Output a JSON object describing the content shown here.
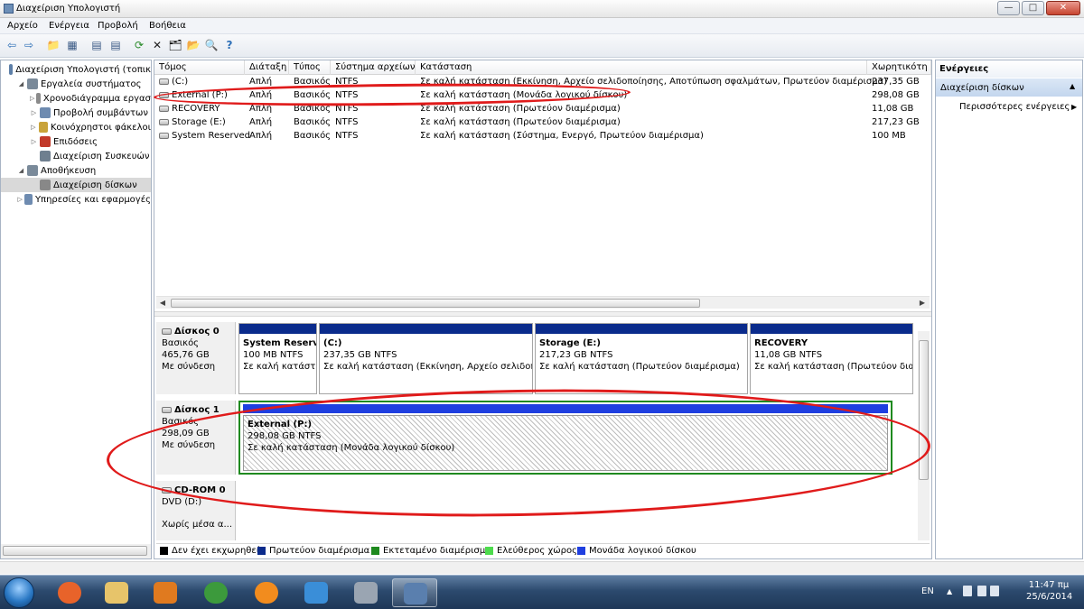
{
  "window": {
    "title": "Διαχείριση Υπολογιστή",
    "minimize_glyph": "—",
    "maximize_glyph": "□",
    "close_glyph": "✕"
  },
  "menu": [
    "Αρχείο",
    "Ενέργεια",
    "Προβολή",
    "Βοήθεια"
  ],
  "toolbar": {
    "icons": [
      "back-arrow-icon",
      "forward-arrow-icon",
      "up-folder-icon",
      "show-hide-tree-icon",
      "properties-icon",
      "refresh-icon",
      "delete-icon",
      "open-icon",
      "explore-icon",
      "search-icon",
      "help-icon"
    ],
    "glyphs": [
      "⇦",
      "⇨",
      "📁",
      "▦",
      "▤",
      "⟳",
      "✕",
      "🗂",
      "📂",
      "🔍",
      "?"
    ]
  },
  "tree": [
    {
      "label": "Διαχείριση Υπολογιστή (τοπικ",
      "expander": "",
      "level": 0,
      "icon_color": "#5d7fa8"
    },
    {
      "label": "Εργαλεία συστήματος",
      "expander": "◢",
      "level": 1,
      "icon_color": "#7a8a9a"
    },
    {
      "label": "Χρονοδιάγραμμα εργασ",
      "expander": "▷",
      "level": 2,
      "icon_color": "#8b8b8b"
    },
    {
      "label": "Προβολή συμβάντων",
      "expander": "▷",
      "level": 2,
      "icon_color": "#6e8bb0"
    },
    {
      "label": "Κοινόχρηστοι φάκελοι",
      "expander": "▷",
      "level": 2,
      "icon_color": "#c9a33a"
    },
    {
      "label": "Επιδόσεις",
      "expander": "▷",
      "level": 2,
      "icon_color": "#c23a2a"
    },
    {
      "label": "Διαχείριση Συσκευών",
      "expander": "",
      "level": 2,
      "icon_color": "#6f7f8f"
    },
    {
      "label": "Αποθήκευση",
      "expander": "◢",
      "level": 1,
      "icon_color": "#7a8a9a"
    },
    {
      "label": "Διαχείριση δίσκων",
      "expander": "",
      "level": 2,
      "icon_color": "#888888",
      "selected": true
    },
    {
      "label": "Υπηρεσίες και εφαρμογές",
      "expander": "▷",
      "level": 1,
      "icon_color": "#6e8bb0"
    }
  ],
  "volumes_table": {
    "headers": [
      "Τόμος",
      "Διάταξη",
      "Τύπος",
      "Σύστημα αρχείων",
      "Κατάσταση",
      "Χωρητικότη"
    ],
    "rows": [
      [
        "(C:)",
        "Απλή",
        "Βασικός",
        "NTFS",
        "Σε καλή κατάσταση (Εκκίνηση, Αρχείο σελιδοποίησης, Αποτύπωση σφαλμάτων, Πρωτεύον διαμέρισμα)",
        "237,35 GB"
      ],
      [
        "External (P:)",
        "Απλή",
        "Βασικός",
        "NTFS",
        "Σε καλή κατάσταση (Μονάδα λογικού δίσκου)",
        "298,08 GB"
      ],
      [
        "RECOVERY",
        "Απλή",
        "Βασικός",
        "NTFS",
        "Σε καλή κατάσταση (Πρωτεύον διαμέρισμα)",
        "11,08 GB"
      ],
      [
        "Storage (E:)",
        "Απλή",
        "Βασικός",
        "NTFS",
        "Σε καλή κατάσταση (Πρωτεύον διαμέρισμα)",
        "217,23 GB"
      ],
      [
        "System Reserved",
        "Απλή",
        "Βασικός",
        "NTFS",
        "Σε καλή κατάσταση (Σύστημα, Ενεργό, Πρωτεύον διαμέρισμα)",
        "100 MB"
      ]
    ]
  },
  "disks": [
    {
      "name": "Δίσκος 0",
      "type": "Βασικός",
      "size": "465,76 GB",
      "status": "Με σύνδεση",
      "partitions": [
        {
          "name": "System Reserv",
          "size": "100 MB NTFS",
          "status": "Σε καλή κατάστ"
        },
        {
          "name": "(C:)",
          "size": "237,35 GB NTFS",
          "status": "Σε καλή κατάσταση (Εκκίνηση, Αρχείο σελιδοποι"
        },
        {
          "name": "Storage  (E:)",
          "size": "217,23 GB NTFS",
          "status": "Σε καλή κατάσταση (Πρωτεύον διαμέρισμα)"
        },
        {
          "name": "RECOVERY",
          "size": "11,08 GB NTFS",
          "status": "Σε καλή κατάσταση (Πρωτεύον διαμ"
        }
      ]
    },
    {
      "name": "Δίσκος 1",
      "type": "Βασικός",
      "size": "298,09 GB",
      "status": "Με σύνδεση",
      "partitions": [
        {
          "name": "External  (P:)",
          "size": "298,08 GB NTFS",
          "status": "Σε καλή κατάσταση (Μονάδα λογικού δίσκου)"
        }
      ]
    },
    {
      "name": "CD-ROM 0",
      "type": "DVD (D:)",
      "size": "",
      "status": "Χωρίς μέσα α..."
    }
  ],
  "legend": [
    {
      "label": "Δεν έχει εκχωρηθεί",
      "color": "#000000"
    },
    {
      "label": "Πρωτεύον διαμέρισμα",
      "color": "#0a2b8c"
    },
    {
      "label": "Εκτεταμένο διαμέρισμα",
      "color": "#1f8a1f"
    },
    {
      "label": "Ελεύθερος χώρος",
      "color": "#4ddb4d"
    },
    {
      "label": "Μονάδα λογικού δίσκου",
      "color": "#1f3fe0"
    }
  ],
  "actions": {
    "header": "Ενέργειες",
    "section": "Διαχείριση δίσκων",
    "more": "Περισσότερες ενέργειες",
    "section_glyph": "▲",
    "more_glyph": "▶"
  },
  "taskbar": {
    "apps": [
      "firefox-icon",
      "explorer-icon",
      "media-player-icon",
      "chrome-icon",
      "orange-app-icon",
      "play-icon",
      "game-app-icon",
      "computer-management-icon"
    ],
    "app_colors": [
      "#e8632a",
      "#e7c46a",
      "#e07a1f",
      "#3c9a3c",
      "#f28c1e",
      "#3a8ed8",
      "#9aa5b2",
      "#5a7fae"
    ],
    "language": "EN",
    "time": "11:47 πμ",
    "date": "25/6/2014"
  },
  "colors": {
    "primary_partition": "#0a2b8c",
    "logical_drive": "#1f3fe0",
    "extended_partition": "#1f8a1f",
    "annotation": "#e01b1b"
  }
}
